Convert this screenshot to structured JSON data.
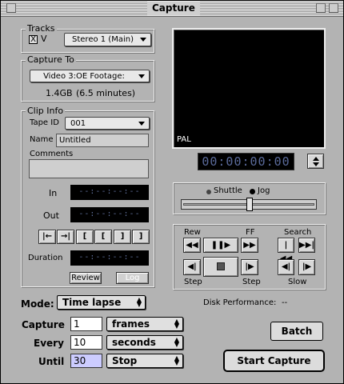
{
  "window": {
    "title": "Capture"
  },
  "tracks": {
    "legend": "Tracks",
    "checkbox_mark": "X",
    "video_label": "V",
    "audio_value": "Stereo 1 (Main)"
  },
  "capture_to": {
    "legend": "Capture To",
    "target": "Video 3:OE Footage:",
    "free_space": "1.4GB",
    "duration": "(6.5 minutes)"
  },
  "clip_info": {
    "legend": "Clip Info",
    "tape_id_label": "Tape ID",
    "tape_id_value": "001",
    "name_label": "Name",
    "name_value": "Untitled",
    "comments_label": "Comments",
    "comments_value": "",
    "in_label": "In",
    "in_value": "--:--:--:--",
    "out_label": "Out",
    "out_value": "--:--:--:--",
    "duration_label": "Duration",
    "duration_value": "--:--:--:--",
    "review_label": "Review",
    "log_label": "Log"
  },
  "preview": {
    "format": "PAL"
  },
  "timecode": {
    "value": "00:00:00:00"
  },
  "shuttle": {
    "shuttle_label": "Shuttle",
    "jog_label": "Jog",
    "selected": "Jog"
  },
  "transport": {
    "rew_label": "Rew",
    "ff_label": "FF",
    "search_label": "Search",
    "step_left_label": "Step",
    "step_right_label": "Step",
    "slow_label": "Slow"
  },
  "mode": {
    "label": "Mode:",
    "value": "Time lapse"
  },
  "disk": {
    "label": "Disk Performance:",
    "value": "--"
  },
  "timelapse": {
    "capture_label": "Capture",
    "capture_value": "1",
    "capture_unit": "frames",
    "every_label": "Every",
    "every_value": "10",
    "every_unit": "seconds",
    "until_label": "Until",
    "until_value": "30",
    "until_unit": "Stop"
  },
  "buttons": {
    "batch": "Batch",
    "start_capture": "Start Capture"
  },
  "colors": {
    "window_bg": "#b3b3b3",
    "timecode_text": "#5f6f9a",
    "selected_field": "#ccccff"
  }
}
